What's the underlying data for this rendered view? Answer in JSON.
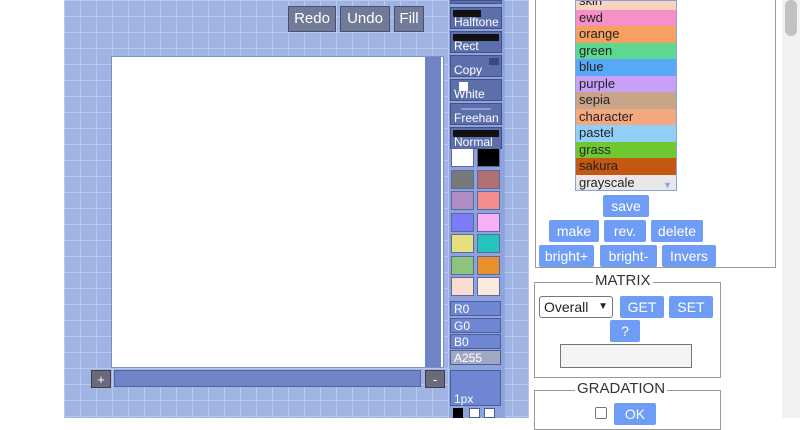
{
  "toolbar": {
    "redo_label": "Redo",
    "undo_label": "Undo",
    "fill_label": "Fill"
  },
  "canvas": {
    "plus_label": "+",
    "minus_label": "-"
  },
  "tools": {
    "halftone_label": "Halftone",
    "rect_label": "Rect",
    "copy_label": "Copy",
    "white_label": "White",
    "freehand_label": "Freehan",
    "normal_label": "Normal"
  },
  "palette": {
    "colors": [
      "#ffffff",
      "#000000",
      "#787878",
      "#b07070",
      "#b08cc4",
      "#f48c8c",
      "#7c7cf8",
      "#f8b0f4",
      "#e6e07c",
      "#24c4bc",
      "#8cc47c",
      "#e8902c",
      "#f8dcd0",
      "#fbe8de"
    ]
  },
  "rgba": {
    "r": "R0",
    "g": "G0",
    "b": "B0",
    "a": "A255"
  },
  "pen": {
    "size_label": "1px"
  },
  "palette_list": {
    "items": [
      {
        "label": "skin",
        "color": "#f8d4c0"
      },
      {
        "label": "ewd",
        "color": "#f890c8"
      },
      {
        "label": "orange",
        "color": "#f8a060"
      },
      {
        "label": "green",
        "color": "#5cd890"
      },
      {
        "label": "blue",
        "color": "#58a8f8"
      },
      {
        "label": "purple",
        "color": "#c8a0f8"
      },
      {
        "label": "sepia",
        "color": "#c8a488"
      },
      {
        "label": "character",
        "color": "#f4a880"
      },
      {
        "label": "pastel",
        "color": "#90d0f8"
      },
      {
        "label": "grass",
        "color": "#70c830"
      },
      {
        "label": "sakura",
        "color": "#c45810"
      },
      {
        "label": "grayscale",
        "color": "#e8e8e8"
      }
    ]
  },
  "palette_actions": {
    "save_label": "save",
    "make_label": "make",
    "rev_label": "rev.",
    "delete_label": "delete",
    "bright_plus_label": "bright+",
    "bright_minus_label": "bright-",
    "invers_label": "Invers"
  },
  "matrix": {
    "legend": "MATRIX",
    "select_value": "Overall",
    "get_label": "GET",
    "set_label": "SET",
    "help_label": "?",
    "textarea_value": ""
  },
  "gradation": {
    "legend": "GRADATION",
    "ok_label": "OK"
  }
}
